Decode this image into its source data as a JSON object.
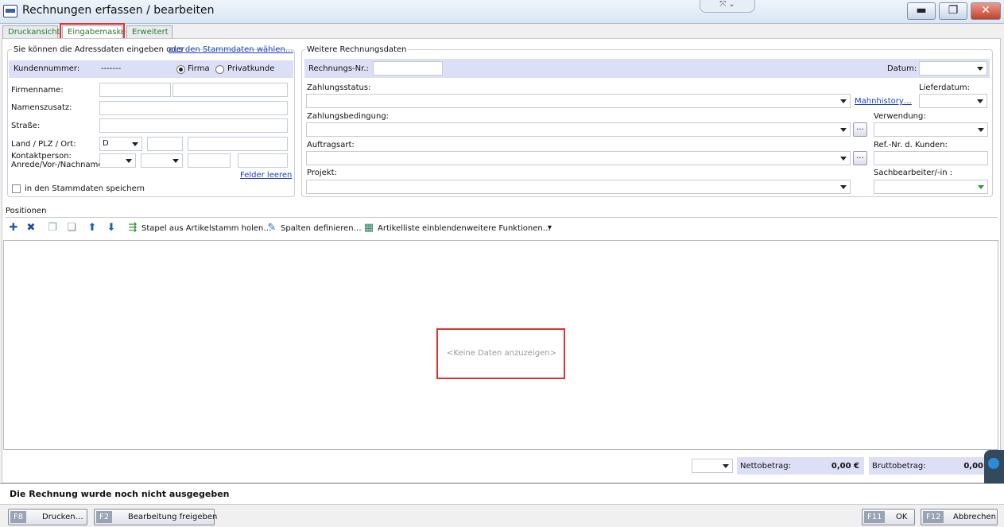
{
  "window": {
    "title": "Rechnungen erfassen / bearbeiten",
    "min": "▬",
    "restore": "❐",
    "close": "✕",
    "handle": "⤧ ⌄"
  },
  "tabs": [
    "Druckansicht",
    "Eingabemaske",
    "Erweitert"
  ],
  "address": {
    "group_title": "Sie können die Adressdaten eingeben oder",
    "stamm_link": "aus den Stammdaten wählen…",
    "kundennummer_label": "Kundennummer:",
    "kundennummer_value": "-------",
    "radio_firma": "Firma",
    "radio_privat": "Privatkunde",
    "firmenname": "Firmenname:",
    "namenszusatz": "Namenszusatz:",
    "strasse": "Straße:",
    "land_plz_ort": "Land / PLZ / Ort:",
    "land_value": "D",
    "kontakt1": "Kontaktperson:",
    "kontakt2": "Anrede/Vor-/Nachname",
    "felder_leeren": "Felder leeren",
    "save_check": "in den Stammdaten speichern"
  },
  "invoice": {
    "group_title": "Weitere Rechnungsdaten",
    "rechnungsnr": "Rechnungs-Nr.:",
    "datum": "Datum:",
    "zahlungsstatus": "Zahlungsstatus:",
    "mahnhistory": "Mahnhistory…",
    "lieferdatum": "Lieferdatum:",
    "zahlungsbedingung": "Zahlungsbedingung:",
    "verwendung": "Verwendung:",
    "auftragsart": "Auftragsart:",
    "refnr": "Ref.-Nr. d. Kunden:",
    "projekt": "Projekt:",
    "sachbearbeiter": "Sachbearbeiter/-in :",
    "dots": "..."
  },
  "positions": {
    "title": "Positionen",
    "stapel": "Stapel aus Artikelstamm holen…",
    "spalten": "Spalten definieren…",
    "artikelliste": "Artikelliste einblenden",
    "weitere": "weitere Funktionen…",
    "empty": "<Keine Daten anzuzeigen>"
  },
  "totals": {
    "netto_label": "Nettobetrag:",
    "netto_value": "0,00 €",
    "brutto_label": "Bruttobetrag:",
    "brutto_value": "0,00"
  },
  "status": "Die Rechnung wurde noch nicht ausgegeben",
  "footer": {
    "f8_key": "F8",
    "f8_label": "Drucken…",
    "f2_key": "F2",
    "f2_label": "Bearbeitung freigeben",
    "f11_key": "F11",
    "f11_label": "OK",
    "f12_key": "F12",
    "f12_label": "Abbrechen"
  },
  "icons": {
    "add": "✚",
    "delete": "✖",
    "copy": "❐",
    "paste": "❏",
    "up": "⬆",
    "down": "⬇",
    "stapel": "⇶",
    "spalten": "✎",
    "artikel": "▦",
    "dropdown": "▾"
  },
  "colors": {
    "accent_band": "#dcdff5",
    "link": "#1a3fc4",
    "highlight": "#dd3333"
  }
}
